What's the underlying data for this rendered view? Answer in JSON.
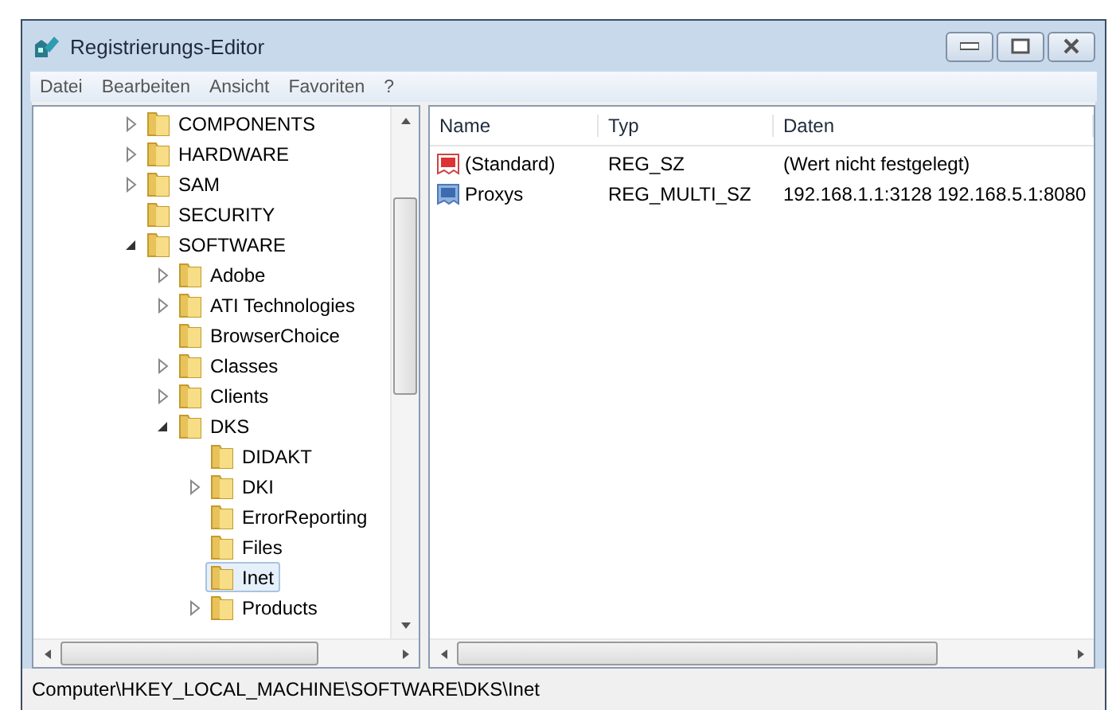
{
  "window": {
    "title": "Registrierungs-Editor"
  },
  "menu": [
    "Datei",
    "Bearbeiten",
    "Ansicht",
    "Favoriten",
    "?"
  ],
  "tree": [
    {
      "label": "COMPONENTS",
      "has_children": true,
      "expanded": false,
      "selected": false
    },
    {
      "label": "HARDWARE",
      "has_children": true,
      "expanded": false,
      "selected": false
    },
    {
      "label": "SAM",
      "has_children": true,
      "expanded": false,
      "selected": false
    },
    {
      "label": "SECURITY",
      "has_children": false,
      "selected": false
    },
    {
      "label": "SOFTWARE",
      "has_children": true,
      "expanded": true,
      "selected": false,
      "children": [
        {
          "label": "Adobe",
          "has_children": true,
          "expanded": false,
          "selected": false
        },
        {
          "label": "ATI Technologies",
          "has_children": true,
          "expanded": false,
          "selected": false
        },
        {
          "label": "BrowserChoice",
          "has_children": false,
          "selected": false
        },
        {
          "label": "Classes",
          "has_children": true,
          "expanded": false,
          "selected": false
        },
        {
          "label": "Clients",
          "has_children": true,
          "expanded": false,
          "selected": false
        },
        {
          "label": "DKS",
          "has_children": true,
          "expanded": true,
          "selected": false,
          "children": [
            {
              "label": "DIDAKT",
              "has_children": false,
              "selected": false
            },
            {
              "label": "DKI",
              "has_children": true,
              "expanded": false,
              "selected": false
            },
            {
              "label": "ErrorReporting",
              "has_children": false,
              "selected": false
            },
            {
              "label": "Files",
              "has_children": false,
              "selected": false
            },
            {
              "label": "Inet",
              "has_children": false,
              "selected": true
            },
            {
              "label": "Products",
              "has_children": true,
              "expanded": false,
              "selected": false
            }
          ]
        }
      ]
    }
  ],
  "table": {
    "columns": [
      "Name",
      "Typ",
      "Daten"
    ],
    "rows": [
      {
        "kind": "string",
        "name": "(Standard)",
        "type": "REG_SZ",
        "data": "(Wert nicht festgelegt)"
      },
      {
        "kind": "multi",
        "name": "Proxys",
        "type": "REG_MULTI_SZ",
        "data": "192.168.1.1:3128 192.168.5.1:8080"
      }
    ]
  },
  "status_bar": "Computer\\HKEY_LOCAL_MACHINE\\SOFTWARE\\DKS\\Inet"
}
